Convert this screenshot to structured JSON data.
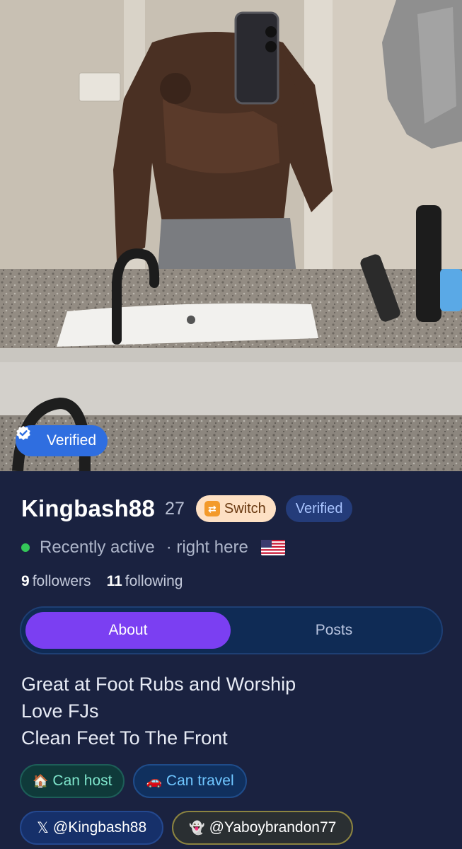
{
  "photo": {
    "badge_label": "Verified",
    "badge_icon": "verified-check-icon"
  },
  "profile": {
    "username": "Kingbash88",
    "age": "27",
    "switch_label": "Switch",
    "switch_icon": "switch-arrows-icon",
    "verified_label": "Verified",
    "status": "Recently active",
    "location": "· right here",
    "flag": "us-flag-icon",
    "followers_count": "9",
    "followers_label": "followers",
    "following_count": "11",
    "following_label": "following"
  },
  "tabs": [
    {
      "label": "About",
      "active": true
    },
    {
      "label": "Posts",
      "active": false
    }
  ],
  "bio": {
    "lines": [
      "Great at Foot Rubs and Worship",
      "Love FJs",
      "Clean Feet To The Front"
    ]
  },
  "tags": {
    "host": {
      "icon": "🏠",
      "label": "Can host"
    },
    "travel": {
      "icon": "🚗",
      "label": "Can travel"
    }
  },
  "socials": {
    "x": {
      "icon": "𝕏",
      "label": "@Kingbash88"
    },
    "snapchat": {
      "icon": "👻",
      "label": "@Yaboybrandon77"
    }
  },
  "colors": {
    "background": "#1a2240",
    "photo_badge": "#2f6ee0",
    "tab_active": "#7b3ff2",
    "status_online": "#34c759"
  }
}
